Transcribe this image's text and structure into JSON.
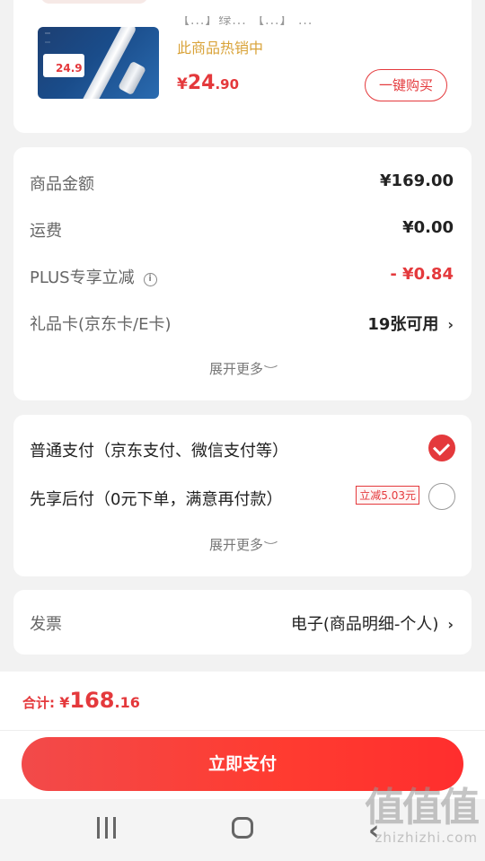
{
  "product": {
    "title_partial": "【...】绿... 【...】 ...",
    "status": "此商品热销中",
    "price_symbol": "¥",
    "price_int": "24",
    "price_dec": ".90",
    "buy_label": "一键购买",
    "image_promo_price": "24.9"
  },
  "amounts": {
    "rows": [
      {
        "label": "商品金额",
        "value": "¥169.00"
      },
      {
        "label": "运费",
        "value": "¥0.00"
      },
      {
        "label": "PLUS专享立减",
        "value": "- ¥0.84"
      },
      {
        "label": "礼品卡(京东卡/E卡)",
        "value": "19张可用"
      }
    ],
    "expand_label": "展开更多"
  },
  "payment": {
    "options": [
      {
        "label": "普通支付（京东支付、微信支付等）",
        "selected": true
      },
      {
        "label": "先享后付（0元下单，满意再付款）",
        "badge": "立减5.03元",
        "selected": false
      }
    ],
    "expand_label": "展开更多"
  },
  "invoice": {
    "label": "发票",
    "value": "电子(商品明细-个人)"
  },
  "footer": {
    "total_label": "合计: ",
    "total_symbol": "¥",
    "total_int": "168",
    "total_dec": ".16",
    "pay_label": "立即支付"
  },
  "watermark": {
    "big": "值值值",
    "small": "zhizhizhi.com"
  },
  "colors": {
    "accent": "#e4393c",
    "hot": "#d9a339",
    "background": "#f2f2f2"
  }
}
